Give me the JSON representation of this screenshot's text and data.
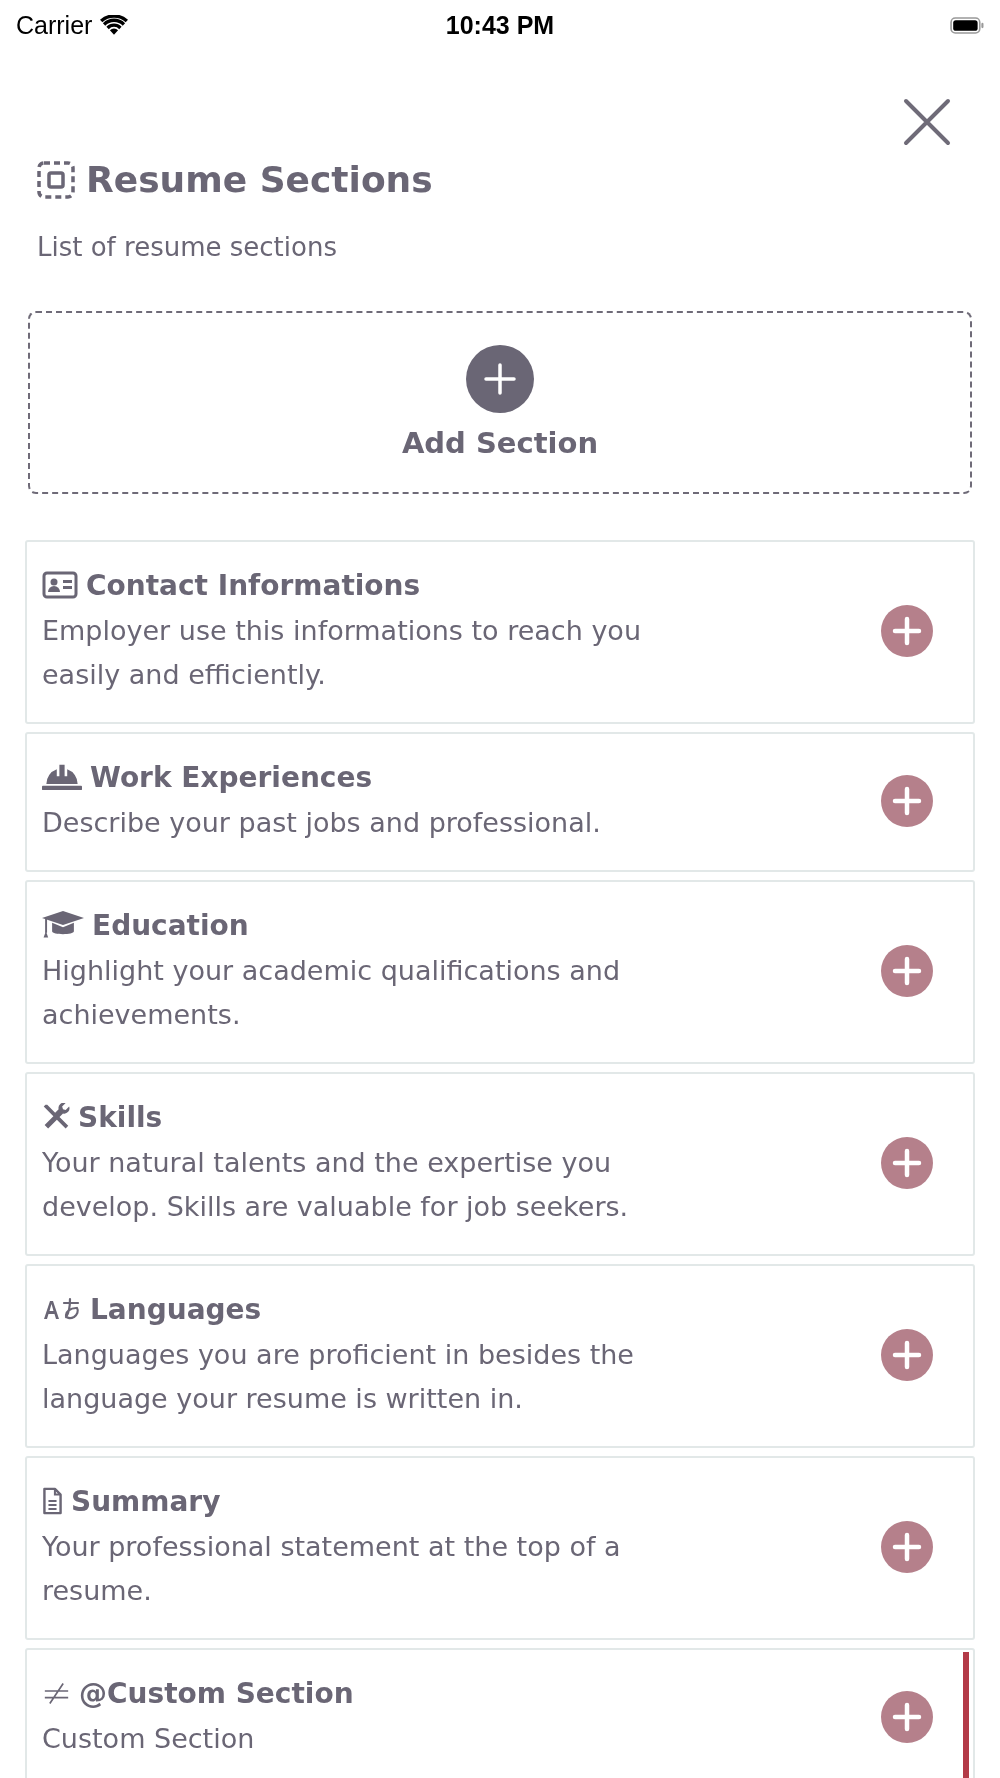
{
  "status_bar": {
    "carrier": "Carrier",
    "time": "10:43 PM"
  },
  "header": {
    "title": "Resume Sections",
    "subtitle": "List of resume sections"
  },
  "add_section": {
    "label": "Add Section"
  },
  "sections": [
    {
      "kind": "standard",
      "title": "Contact Informations",
      "description": "Employer use this informations to reach you easily and efficiently."
    },
    {
      "kind": "standard",
      "title": "Work Experiences",
      "description": "Describe your past jobs and professional."
    },
    {
      "kind": "standard",
      "title": "Education",
      "description": "Highlight your academic qualifications and achievements."
    },
    {
      "kind": "standard",
      "title": "Skills",
      "description": "Your natural talents and the expertise you develop. Skills are valuable for job seekers."
    },
    {
      "kind": "standard",
      "title": "Languages",
      "description": "Languages you are proficient in besides the language your resume is written in."
    },
    {
      "kind": "standard",
      "title": "Summary",
      "description": "Your professional statement at the top of a resume."
    },
    {
      "kind": "custom",
      "title": "@Custom Section",
      "description": "Custom Section"
    }
  ]
}
